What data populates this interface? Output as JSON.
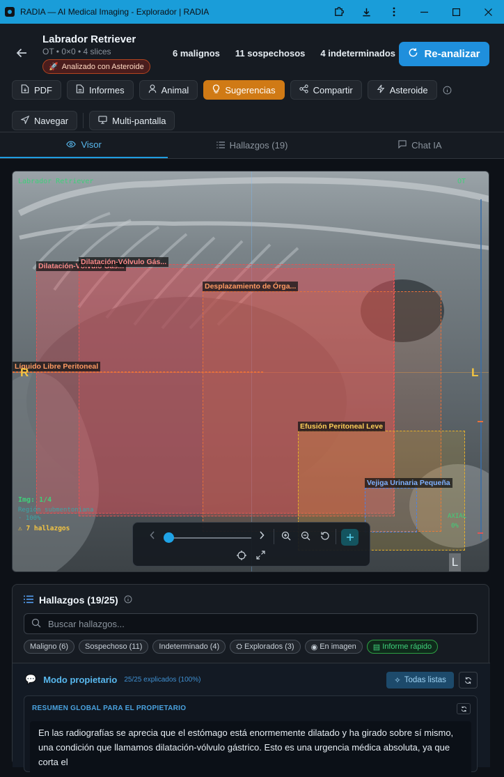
{
  "window": {
    "title": "RADIA — AI Medical Imaging - Explorador | RADIA",
    "icons": [
      "puzzle-icon",
      "download-icon",
      "more-vertical-icon"
    ],
    "controls": [
      "minimize",
      "maximize",
      "close"
    ]
  },
  "patient": {
    "name": "Labrador Retriever",
    "meta": "OT • 0×0 • 4 slices",
    "badge": "Analizado con Asteroide"
  },
  "stats": [
    "6 malignos",
    "11 sospechosos",
    "4 indeterminados"
  ],
  "reanalyze_label": "Re-analizar",
  "toolbar": [
    {
      "label": "PDF",
      "icon": "file-pdf-icon"
    },
    {
      "label": "Informes",
      "icon": "document-icon"
    },
    {
      "label": "Animal",
      "icon": "user-icon"
    },
    {
      "label": "Sugerencias",
      "icon": "lightbulb-icon",
      "active": true
    },
    {
      "label": "Compartir",
      "icon": "share-icon"
    },
    {
      "label": "Asteroide",
      "icon": "zap-icon"
    }
  ],
  "toolbar2": [
    {
      "label": "Navegar",
      "icon": "navigation-icon"
    },
    {
      "label": "Multi-pantalla",
      "icon": "monitor-icon"
    }
  ],
  "tabs": [
    {
      "label": "Visor",
      "icon": "eye-icon",
      "active": true
    },
    {
      "label": "Hallazgos (19)",
      "icon": "list-icon"
    },
    {
      "label": "Chat IA",
      "icon": "chat-icon"
    }
  ],
  "viewer": {
    "top_left": "Labrador Retriever",
    "top_right": "OT",
    "img_index": "Img: 1/4",
    "region_line1": "Región submentoniana",
    "region_line2": "· 100%",
    "hallazgos": "⚠ 7 hallazgos",
    "axial": "AXIAL",
    "axial_pct": "0%",
    "left_marker": "R",
    "right_marker": "L",
    "corner_marker": "L",
    "slice_level": 0,
    "boxes": [
      {
        "label": "Dilatación-Vólvulo Gás...",
        "color": "#e05555"
      },
      {
        "label": "Dilatación-Vólvulo Gás...",
        "color": "#e05555"
      },
      {
        "label": "Desplazamiento de Órga...",
        "color": "#e8703a"
      },
      {
        "label": "Líquido Libre Peritoneal",
        "color": "#e8703a"
      },
      {
        "label": "Efusión Peritoneal Leve",
        "color": "#e6b12a"
      },
      {
        "label": "Vejiga Urinaria Pequeña",
        "color": "#4a82e8"
      }
    ]
  },
  "findings": {
    "title": "Hallazgos (19/25)",
    "search_placeholder": "Buscar hallazgos...",
    "chips": [
      {
        "label": "Maligno (6)"
      },
      {
        "label": "Sospechoso (11)"
      },
      {
        "label": "Indeterminado (4)"
      },
      {
        "label": "Explorados (3)",
        "icon": "explore-icon"
      },
      {
        "label": "En imagen",
        "icon": "eye-icon"
      },
      {
        "label": "Informe rápido",
        "icon": "file-icon",
        "green": true
      }
    ]
  },
  "owner": {
    "title": "Modo propietario",
    "subtitle": "25/25 explicados (100%)",
    "all_ready": "Todas listas",
    "summary_header": "RESUMEN GLOBAL PARA EL PROPIETARIO",
    "summary_text": "En las radiografías se aprecia que el estómago está enormemente dilatado y ha girado sobre sí mismo, una condición que llamamos dilatación-vólvulo gástrico. Esto es una urgencia médica absoluta, ya que corta el"
  }
}
